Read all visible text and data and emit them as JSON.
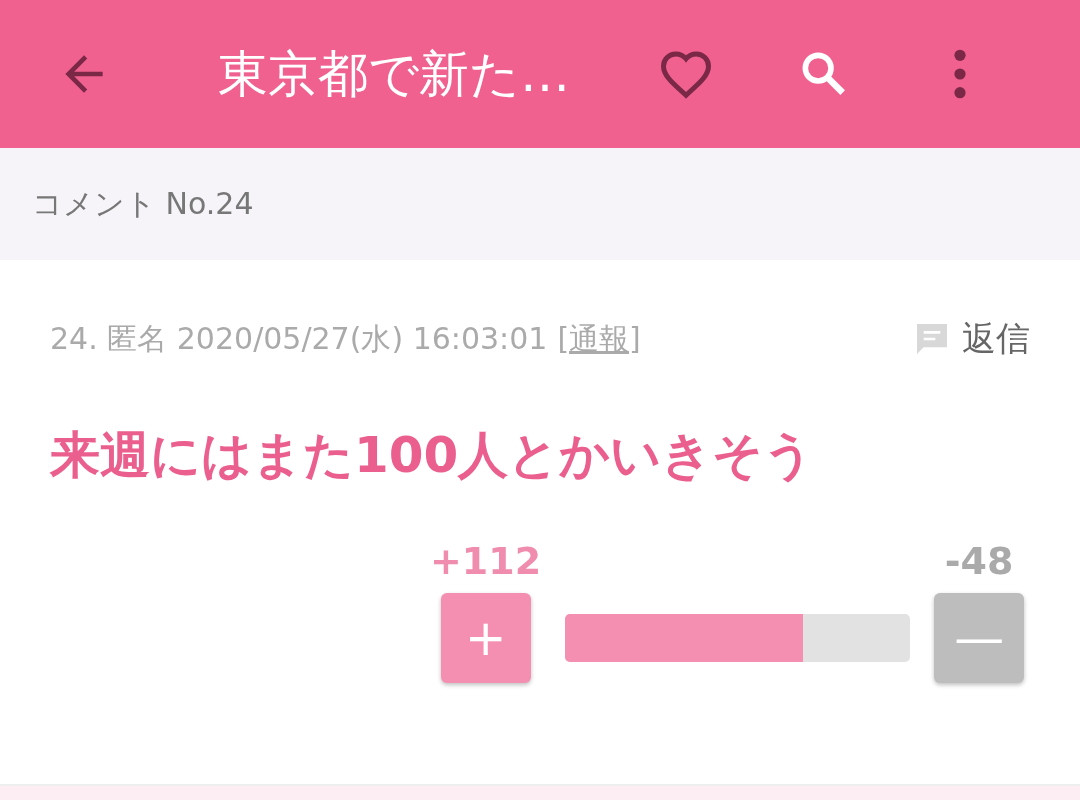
{
  "app_bar": {
    "title": "東京都で新た…"
  },
  "section": {
    "title": "コメント No.24"
  },
  "comment": {
    "meta": "24. 匿名 2020/05/27(水) 16:03:01",
    "report": "[通報]",
    "reply": "返信",
    "body": "来週にはまた100人とかいきそう",
    "votes": {
      "plus_count": "+112",
      "minus_count": "-48",
      "plus_symbol": "+",
      "minus_symbol": "—",
      "level": 0.69
    }
  }
}
